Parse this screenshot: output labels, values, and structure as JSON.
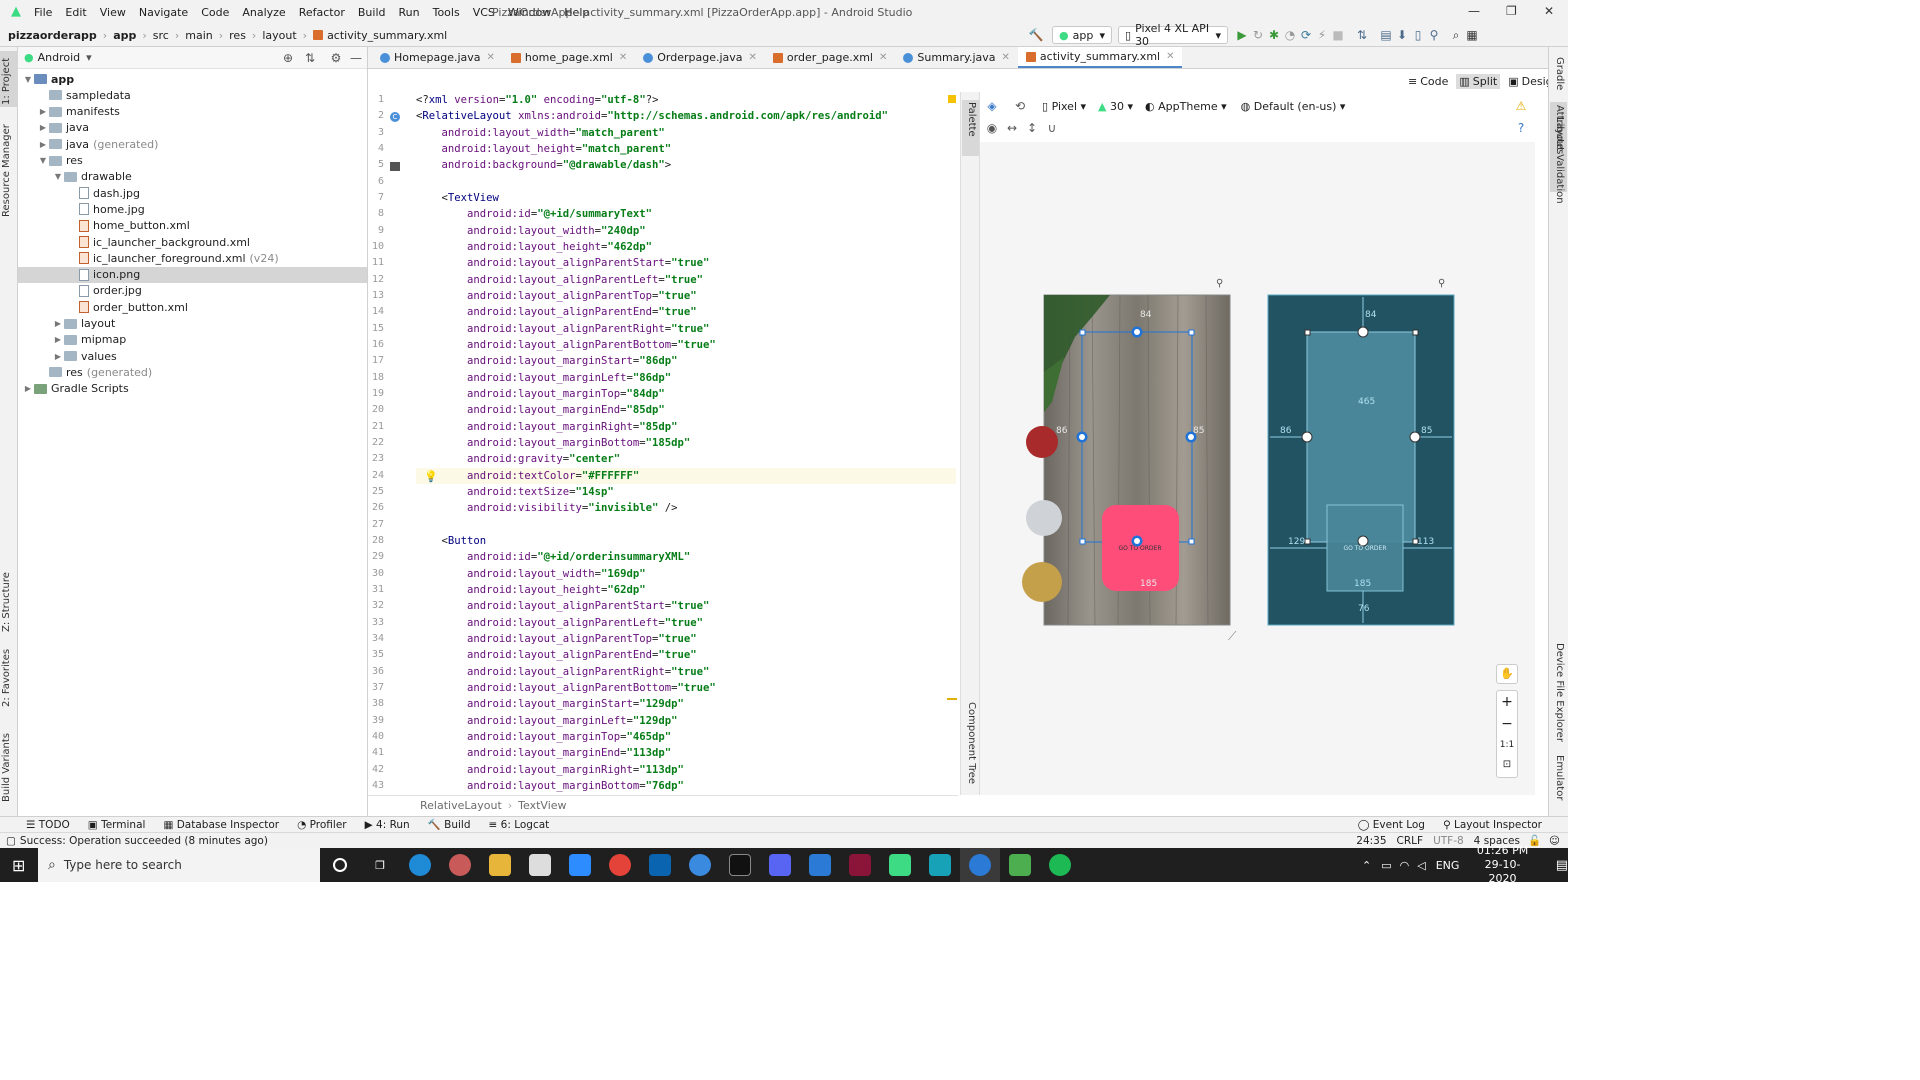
{
  "window": {
    "title": "PizzaOrderApp - activity_summary.xml [PizzaOrderApp.app] - Android Studio",
    "menu": [
      "File",
      "Edit",
      "View",
      "Navigate",
      "Code",
      "Analyze",
      "Refactor",
      "Build",
      "Run",
      "Tools",
      "VCS",
      "Window",
      "Help"
    ],
    "minimize": "—",
    "maximize": "❐",
    "close": "✕"
  },
  "navbar": {
    "crumbs": [
      "pizzaorderapp",
      "app",
      "src",
      "main",
      "res",
      "layout",
      "activity_summary.xml"
    ],
    "run_config": "app",
    "device": "Pixel 4 XL API 30"
  },
  "left_strip_tabs": [
    "1: Project",
    "Resource Manager",
    "Z: Structure",
    "2: Favorites",
    "Build Variants"
  ],
  "right_strip_tabs": [
    "Gradle",
    "Attributes",
    "Layout Validation",
    "Device File Explorer",
    "Emulator"
  ],
  "project": {
    "view_name": "Android",
    "tree": [
      {
        "label": "app",
        "depth": 0,
        "type": "app",
        "open": true
      },
      {
        "label": "sampledata",
        "depth": 1,
        "type": "folder"
      },
      {
        "label": "manifests",
        "depth": 1,
        "type": "folder",
        "collapsed": true
      },
      {
        "label": "java",
        "depth": 1,
        "type": "folder",
        "collapsed": true
      },
      {
        "label": "java",
        "suffix": "(generated)",
        "depth": 1,
        "type": "folder",
        "collapsed": true
      },
      {
        "label": "res",
        "depth": 1,
        "type": "folder",
        "open": true
      },
      {
        "label": "drawable",
        "depth": 2,
        "type": "folder",
        "open": true
      },
      {
        "label": "dash.jpg",
        "depth": 3,
        "type": "file"
      },
      {
        "label": "home.jpg",
        "depth": 3,
        "type": "file"
      },
      {
        "label": "home_button.xml",
        "depth": 3,
        "type": "xml"
      },
      {
        "label": "ic_launcher_background.xml",
        "depth": 3,
        "type": "xml"
      },
      {
        "label": "ic_launcher_foreground.xml",
        "suffix": "(v24)",
        "depth": 3,
        "type": "xml"
      },
      {
        "label": "icon.png",
        "depth": 3,
        "type": "file",
        "selected": true
      },
      {
        "label": "order.jpg",
        "depth": 3,
        "type": "file"
      },
      {
        "label": "order_button.xml",
        "depth": 3,
        "type": "xml"
      },
      {
        "label": "layout",
        "depth": 2,
        "type": "folder",
        "collapsed": true
      },
      {
        "label": "mipmap",
        "depth": 2,
        "type": "folder",
        "collapsed": true
      },
      {
        "label": "values",
        "depth": 2,
        "type": "folder",
        "collapsed": true
      },
      {
        "label": "res",
        "suffix": "(generated)",
        "depth": 1,
        "type": "folder"
      },
      {
        "label": "Gradle Scripts",
        "depth": 0,
        "type": "gradle",
        "collapsed": true
      }
    ]
  },
  "tabs": [
    {
      "label": "Homepage.java",
      "kind": "java"
    },
    {
      "label": "home_page.xml",
      "kind": "xml"
    },
    {
      "label": "Orderpage.java",
      "kind": "java"
    },
    {
      "label": "order_page.xml",
      "kind": "xml"
    },
    {
      "label": "Summary.java",
      "kind": "java"
    },
    {
      "label": "activity_summary.xml",
      "kind": "xml",
      "active": true
    }
  ],
  "view_modes": {
    "code": "Code",
    "split": "Split",
    "design": "Design"
  },
  "design_toolbar": {
    "device": "Pixel",
    "api": "30",
    "theme": "AppTheme",
    "locale": "Default (en-us)"
  },
  "side_panels": {
    "palette": "Palette",
    "component_tree": "Component Tree"
  },
  "code_lines": [
    "<?xml version=\"1.0\" encoding=\"utf-8\"?>",
    "<RelativeLayout xmlns:android=\"http://schemas.android.com/apk/res/android\"",
    "    android:layout_width=\"match_parent\"",
    "    android:layout_height=\"match_parent\"",
    "    android:background=\"@drawable/dash\">",
    "",
    "    <TextView",
    "        android:id=\"@+id/summaryText\"",
    "        android:layout_width=\"240dp\"",
    "        android:layout_height=\"462dp\"",
    "        android:layout_alignParentStart=\"true\"",
    "        android:layout_alignParentLeft=\"true\"",
    "        android:layout_alignParentTop=\"true\"",
    "        android:layout_alignParentEnd=\"true\"",
    "        android:layout_alignParentRight=\"true\"",
    "        android:layout_alignParentBottom=\"true\"",
    "        android:layout_marginStart=\"86dp\"",
    "        android:layout_marginLeft=\"86dp\"",
    "        android:layout_marginTop=\"84dp\"",
    "        android:layout_marginEnd=\"85dp\"",
    "        android:layout_marginRight=\"85dp\"",
    "        android:layout_marginBottom=\"185dp\"",
    "        android:gravity=\"center\"",
    "        android:textColor=\"#FFFFFF\"",
    "        android:textSize=\"14sp\"",
    "        android:visibility=\"invisible\" />",
    "",
    "    <Button",
    "        android:id=\"@+id/orderinsummaryXML\"",
    "        android:layout_width=\"169dp\"",
    "        android:layout_height=\"62dp\"",
    "        android:layout_alignParentStart=\"true\"",
    "        android:layout_alignParentLeft=\"true\"",
    "        android:layout_alignParentTop=\"true\"",
    "        android:layout_alignParentEnd=\"true\"",
    "        android:layout_alignParentRight=\"true\"",
    "        android:layout_alignParentBottom=\"true\"",
    "        android:layout_marginStart=\"129dp\"",
    "        android:layout_marginLeft=\"129dp\"",
    "        android:layout_marginTop=\"465dp\"",
    "        android:layout_marginEnd=\"113dp\"",
    "        android:layout_marginRight=\"113dp\"",
    "        android:layout_marginBottom=\"76dp\""
  ],
  "editor_breadcrumb": [
    "RelativeLayout",
    "TextView"
  ],
  "design_preview": {
    "button_text": "GO TO ORDER",
    "margin_top": "84",
    "margin_left": "86",
    "margin_right": "85",
    "margin_bottom": "185",
    "button_margin_left": "129",
    "button_margin_right": "113",
    "button_margin_bottom": "76",
    "button_margin_top": "465"
  },
  "zoom_controls": [
    "+",
    "−",
    "1:1"
  ],
  "tool_windows": {
    "left": [
      "TODO",
      "Terminal",
      "Database Inspector",
      "Profiler",
      "4: Run",
      "Build",
      "6: Logcat"
    ],
    "right": [
      "Event Log",
      "Layout Inspector"
    ]
  },
  "status": {
    "message": "Success: Operation succeeded (8 minutes ago)",
    "caret": "24:35",
    "line_sep": "CRLF",
    "encoding": "UTF-8",
    "indent": "4 spaces"
  },
  "taskbar": {
    "search_placeholder": "Type here to search",
    "lang": "ENG",
    "time": "01:26 PM",
    "date": "29-10-2020"
  },
  "colors": {
    "accent": "#4a86c8",
    "button_pink": "#ff4d7a",
    "blueprint": "#215363"
  }
}
